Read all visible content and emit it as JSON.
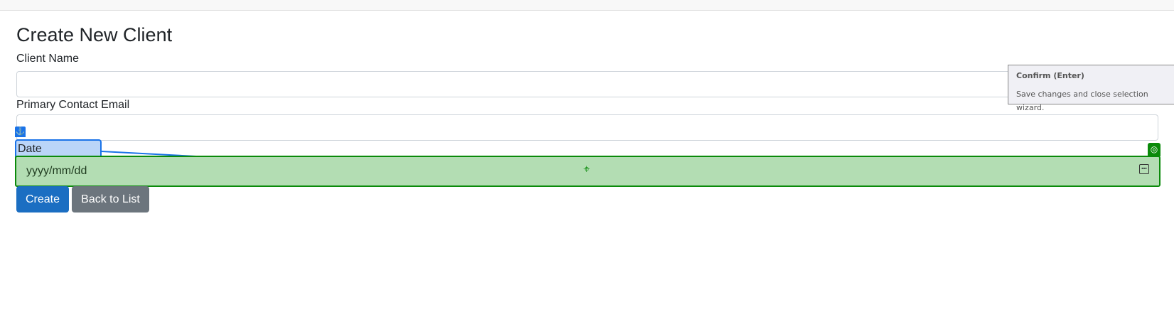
{
  "page": {
    "title": "Create New Client"
  },
  "form": {
    "client_name_label": "Client Name",
    "client_name_value": "",
    "email_label": "Primary Contact Email",
    "email_value": "",
    "date_label": "Date Onboarded",
    "date_placeholder": "yyyy/mm/dd"
  },
  "buttons": {
    "create": "Create",
    "back": "Back to List"
  },
  "tooltip": {
    "title": "Confirm (Enter)",
    "text": "Save changes and close selection wizard."
  },
  "colors": {
    "primary": "#1b6ec2",
    "secondary": "#6c757d",
    "highlight_green": "#0a8a0a",
    "highlight_blue": "#1a73e8"
  }
}
